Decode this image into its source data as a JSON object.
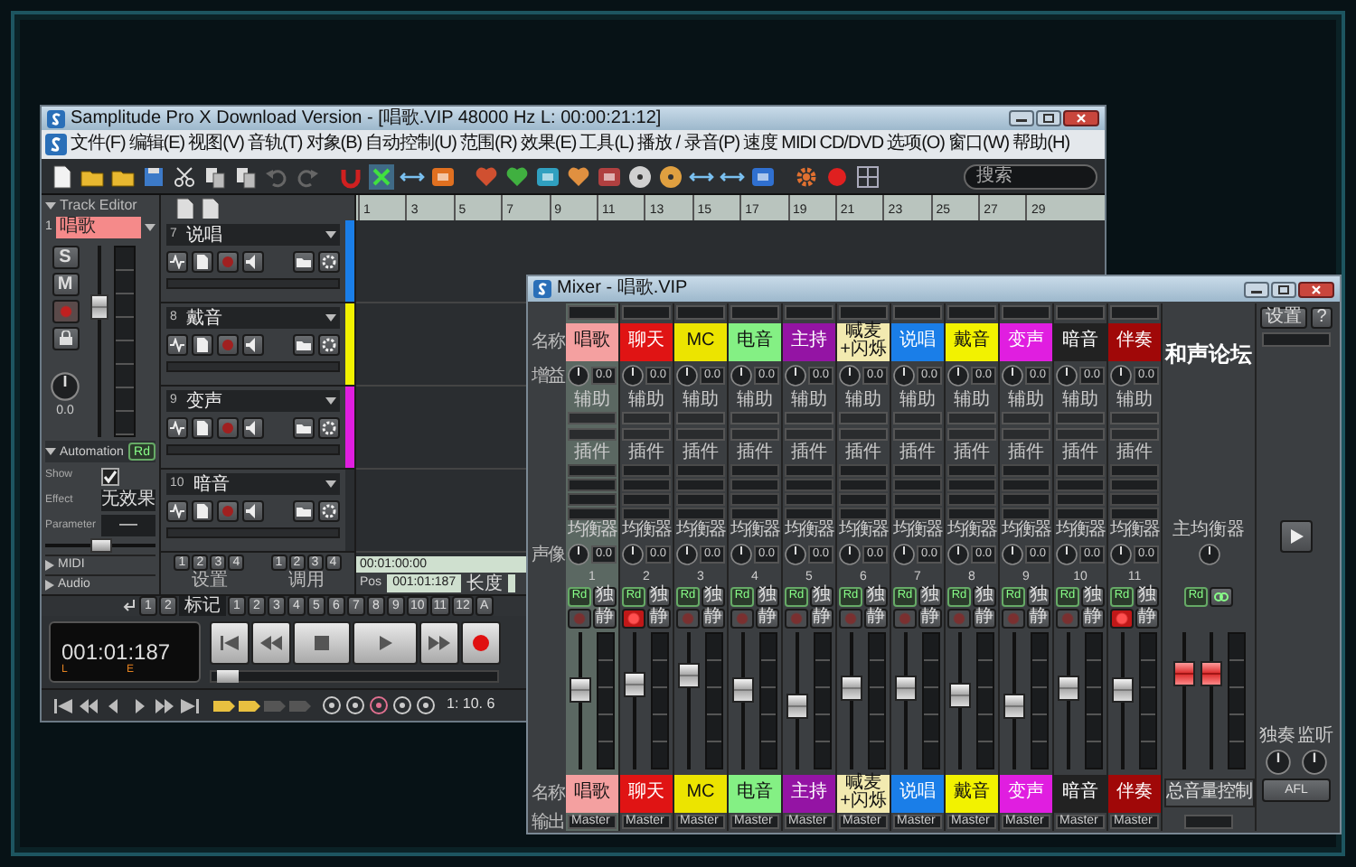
{
  "app": {
    "title": "Samplitude Pro X Download Version - [唱歌.VIP 48000 Hz L: 00:00:21:12]",
    "menu": [
      "文件(F)",
      "编辑(E)",
      "视图(V)",
      "音轨(T)",
      "对象(B)",
      "自动控制(U)",
      "范围(R)",
      "效果(E)",
      "工具(L)",
      "播放 / 录音(P)",
      "速度",
      "MIDI",
      "CD/DVD",
      "选项(O)",
      "窗口(W)",
      "帮助(H)"
    ],
    "search": {
      "placeholder": "搜索"
    },
    "ruler": [
      "1",
      "3",
      "5",
      "7",
      "9",
      "11",
      "13",
      "15",
      "17",
      "19",
      "21",
      "23",
      "25",
      "27",
      "29"
    ]
  },
  "track_editor": {
    "title": "Track Editor",
    "number": "1",
    "name": "唱歌",
    "solo": "S",
    "mute": "M",
    "pan": "0.0",
    "fader": {
      "level": 0.7
    },
    "automation": {
      "title": "Automation",
      "mode": "Rd",
      "show": "Show",
      "show_checked": true,
      "effect": "Effect",
      "effect_value": "无效果",
      "parameter": "Parameter",
      "parameter_value": "—",
      "slider": {
        "level": 0.5
      }
    },
    "sections": [
      "MIDI",
      "Audio"
    ]
  },
  "tracks": [
    {
      "number": "7",
      "name": "说唱",
      "color": "#1a7ee8"
    },
    {
      "number": "8",
      "name": "戴音",
      "color": "#f2f200"
    },
    {
      "number": "9",
      "name": "变声",
      "color": "#e01ee0"
    },
    {
      "number": "10",
      "name": "暗音"
    }
  ],
  "groups": [
    {
      "numbers": [
        "1",
        "2",
        "3",
        "4"
      ],
      "label": "设置"
    },
    {
      "numbers": [
        "1",
        "2",
        "3",
        "4"
      ],
      "label": "调用"
    }
  ],
  "position": {
    "timecode": "00:01:00:00",
    "pos_label": "Pos",
    "pos_value": "001:01:187",
    "length_label": "长度"
  },
  "markers": [
    {
      "label": "1",
      "kind": "button"
    },
    {
      "label": "2",
      "kind": "button"
    },
    {
      "label": "标记",
      "kind": "label"
    },
    {
      "label": "1",
      "kind": "button"
    },
    {
      "label": "2",
      "kind": "button"
    },
    {
      "label": "3",
      "kind": "button"
    },
    {
      "label": "4",
      "kind": "button"
    },
    {
      "label": "5",
      "kind": "button"
    },
    {
      "label": "6",
      "kind": "button"
    },
    {
      "label": "7",
      "kind": "button"
    },
    {
      "label": "8",
      "kind": "button"
    },
    {
      "label": "9",
      "kind": "button"
    },
    {
      "label": "10",
      "kind": "button"
    },
    {
      "label": "11",
      "kind": "button"
    },
    {
      "label": "12",
      "kind": "button"
    },
    {
      "label": "A",
      "kind": "button"
    }
  ],
  "transport": {
    "time": "001:01:187",
    "left": "L",
    "right": "E",
    "slider": {
      "level": 0.02
    }
  },
  "zoom_readout": "1: 10. 6",
  "mixer": {
    "title": "Mixer - 唱歌.VIP",
    "logo": "和声论坛",
    "row_labels": {
      "name": "名称",
      "gain": "增益",
      "pan": "声像",
      "name_bottom": "名称",
      "output": "输出"
    },
    "channels": [
      {
        "number": "1",
        "name": "唱歌",
        "name_bottom": "唱歌",
        "color": "#f4a0a0",
        "selected": true,
        "gain": "0.0",
        "aux_label": "辅助",
        "insert_label": "插件",
        "eq_label": "均衡器",
        "pan": "0.0",
        "mode": "Rd",
        "solo": "独",
        "mute": "静",
        "armed": false,
        "level": 0.6,
        "output": "Master"
      },
      {
        "number": "2",
        "name": "聊天",
        "name_bottom": "聊天",
        "color": "#e01414",
        "selected": false,
        "gain": "0.0",
        "aux_label": "辅助",
        "insert_label": "插件",
        "eq_label": "均衡器",
        "pan": "0.0",
        "mode": "Rd",
        "solo": "独",
        "mute": "静",
        "armed": true,
        "level": 0.65,
        "output": "Master"
      },
      {
        "number": "3",
        "name": "MC",
        "name_bottom": "MC",
        "color": "#ece400",
        "selected": false,
        "gain": "0.0",
        "aux_label": "辅助",
        "insert_label": "插件",
        "eq_label": "均衡器",
        "pan": "0.0",
        "mode": "Rd",
        "solo": "独",
        "mute": "静",
        "armed": false,
        "level": 0.72,
        "output": "Master"
      },
      {
        "number": "4",
        "name": "电音",
        "name_bottom": "电音",
        "color": "#84f084",
        "selected": false,
        "gain": "0.0",
        "aux_label": "辅助",
        "insert_label": "插件",
        "eq_label": "均衡器",
        "pan": "0.0",
        "mode": "Rd",
        "solo": "独",
        "mute": "静",
        "armed": false,
        "level": 0.6,
        "output": "Master"
      },
      {
        "number": "5",
        "name": "主持",
        "name_bottom": "主持",
        "color": "#9414a4",
        "selected": false,
        "gain": "0.0",
        "aux_label": "辅助",
        "insert_label": "插件",
        "eq_label": "均衡器",
        "pan": "0.0",
        "mode": "Rd",
        "solo": "独",
        "mute": "静",
        "armed": false,
        "level": 0.45,
        "output": "Master"
      },
      {
        "number": "6",
        "name": "喊麦+闪烁",
        "name_bottom": "喊麦+闪烁",
        "color": "#f2eab0",
        "selected": false,
        "gain": "0.0",
        "aux_label": "辅助",
        "insert_label": "插件",
        "eq_label": "均衡器",
        "pan": "0.0",
        "mode": "Rd",
        "solo": "独",
        "mute": "静",
        "armed": false,
        "level": 0.62,
        "output": "Master"
      },
      {
        "number": "7",
        "name": "说唱",
        "name_bottom": "说唱",
        "color": "#1a7ee8",
        "selected": false,
        "gain": "0.0",
        "aux_label": "辅助",
        "insert_label": "插件",
        "eq_label": "均衡器",
        "pan": "0.0",
        "mode": "Rd",
        "solo": "独",
        "mute": "静",
        "armed": false,
        "level": 0.62,
        "output": "Master"
      },
      {
        "number": "8",
        "name": "戴音",
        "name_bottom": "戴音",
        "color": "#f2f200",
        "selected": false,
        "gain": "0.0",
        "aux_label": "辅助",
        "insert_label": "插件",
        "eq_label": "均衡器",
        "pan": "0.0",
        "mode": "Rd",
        "solo": "独",
        "mute": "静",
        "armed": false,
        "level": 0.55,
        "output": "Master"
      },
      {
        "number": "9",
        "name": "变声",
        "name_bottom": "变声",
        "color": "#e01ee0",
        "selected": false,
        "gain": "0.0",
        "aux_label": "辅助",
        "insert_label": "插件",
        "eq_label": "均衡器",
        "pan": "0.0",
        "mode": "Rd",
        "solo": "独",
        "mute": "静",
        "armed": false,
        "level": 0.45,
        "output": "Master"
      },
      {
        "number": "10",
        "name": "暗音",
        "name_bottom": "暗音",
        "color": "#222222",
        "selected": false,
        "gain": "0.0",
        "aux_label": "辅助",
        "insert_label": "插件",
        "eq_label": "均衡器",
        "pan": "0.0",
        "mode": "Rd",
        "solo": "独",
        "mute": "静",
        "armed": false,
        "level": 0.62,
        "output": "Master"
      },
      {
        "number": "11",
        "name": "伴奏",
        "name_bottom": "伴奏",
        "color": "#a00808",
        "selected": false,
        "gain": "0.0",
        "aux_label": "辅助",
        "insert_label": "插件",
        "eq_label": "均衡器",
        "pan": "0.0",
        "mode": "Rd",
        "solo": "独",
        "mute": "静",
        "armed": true,
        "level": 0.6,
        "output": "Master"
      }
    ],
    "master": {
      "eq_label": "主均衡器",
      "mode": "Rd",
      "fader": {
        "level": 0.75
      },
      "name": "总音量控制"
    },
    "controls": {
      "settings": "设置",
      "help": "?",
      "knobs": [
        "独奏",
        "监听"
      ],
      "afl": "AFL"
    }
  }
}
